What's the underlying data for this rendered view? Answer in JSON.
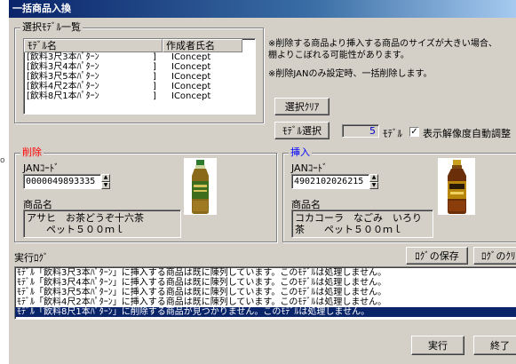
{
  "window": {
    "title": "一括商品入換"
  },
  "model_list": {
    "group_title": "選択ﾓﾃﾞﾙ一覧",
    "columns": [
      "ﾓﾃﾞﾙ名",
      "作成者氏名"
    ],
    "rows": [
      {
        "name": "[飲料3尺3本ﾊﾟﾀｰﾝ",
        "bracket": "]",
        "author": "IConcept"
      },
      {
        "name": "[飲料3尺4本ﾊﾟﾀｰﾝ",
        "bracket": "]",
        "author": "IConcept"
      },
      {
        "name": "[飲料3尺5本ﾊﾟﾀｰﾝ",
        "bracket": "]",
        "author": "IConcept"
      },
      {
        "name": "[飲料4尺2本ﾊﾟﾀｰﾝ",
        "bracket": "]",
        "author": "IConcept"
      },
      {
        "name": "[飲料8尺1本ﾊﾟﾀｰﾝ",
        "bracket": "]",
        "author": "IConcept"
      }
    ]
  },
  "notes": {
    "note1_line1": "※削除する商品より挿入する商品のサイズが大きい場合、",
    "note1_line2": "棚よりこぼれる可能性があります。",
    "note2": "※削除JANのみ設定時、一括削除します。"
  },
  "controls": {
    "clear_button": "選択ｸﾘｱ",
    "select_button": "ﾓﾃﾞﾙ選択",
    "model_count": "5",
    "model_unit": "ﾓﾃﾞﾙ",
    "auto_adjust_label": "表示解像度自動調整",
    "auto_adjust_check": "✓"
  },
  "delete_panel": {
    "title": "削除",
    "jan_label": "JANｺｰﾄﾞ",
    "jan_value": "0000049893335",
    "product_label": "商品名",
    "product_line1": "アサヒ　お茶どうぞ十六茶",
    "product_line2": "　　ペット５００ｍｌ"
  },
  "insert_panel": {
    "title": "挿入",
    "jan_label": "JANｺｰﾄﾞ",
    "jan_value": "4902102026215",
    "product_label": "商品名",
    "product_line1": "コカコーラ　なごみ　いろり",
    "product_line2": "茶　　ペット５００ｍｌ"
  },
  "log": {
    "title": "実行ﾛｸﾞ",
    "save_button": "ﾛｸﾞの保存",
    "clear_button": "ﾛｸﾞのｸﾘｱ",
    "lines": [
      "ﾓﾃﾞﾙ「飲料3尺3本ﾊﾟﾀｰﾝ」に挿入する商品は既に陳列しています。このﾓﾃﾞﾙは処理しません。",
      "ﾓﾃﾞﾙ「飲料3尺4本ﾊﾟﾀｰﾝ」に挿入する商品は既に陳列しています。このﾓﾃﾞﾙは処理しません。",
      "ﾓﾃﾞﾙ「飲料3尺5本ﾊﾟﾀｰﾝ」に挿入する商品は既に陳列しています。このﾓﾃﾞﾙは処理しません。",
      "ﾓﾃﾞﾙ「飲料4尺2本ﾊﾟﾀｰﾝ」に挿入する商品は既に陳列しています。このﾓﾃﾞﾙは処理しません。",
      "ﾓﾃﾞﾙ「飲料8尺1本ﾊﾟﾀｰﾝ」に削除する商品が見つかりません。このﾓﾃﾞﾙは処理しません。"
    ]
  },
  "footer": {
    "run_button": "実行",
    "exit_button": "終了"
  },
  "colors": {
    "delete_title": "#ff0000",
    "insert_title": "#0000ff",
    "selection": "#0a246a"
  }
}
